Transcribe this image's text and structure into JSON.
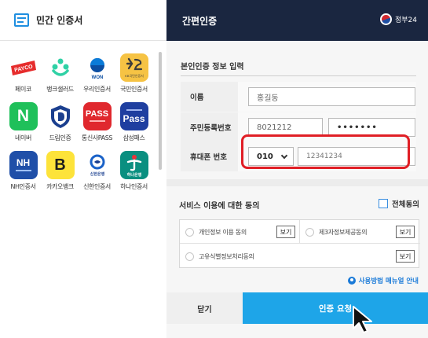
{
  "left_panel": {
    "title": "민간 인증서",
    "providers": [
      {
        "name": "payco",
        "label": "페이코",
        "logo_text": "PAYCO",
        "bg": "#ffffff",
        "fg": "#ffffff",
        "accent": "#e62c2c",
        "icon": "payco-icon"
      },
      {
        "name": "banksalad",
        "label": "뱅크샐러드",
        "logo_text": "",
        "bg": "#ffffff",
        "fg": "#2fd1a5",
        "accent": "#2fd1a5",
        "icon": "banksalad-icon"
      },
      {
        "name": "woori",
        "label": "우리인증서",
        "logo_text": "WON",
        "bg": "#ffffff",
        "fg": "#0b4ea2",
        "accent": "#0b7bd8",
        "icon": "woori-icon"
      },
      {
        "name": "kb",
        "label": "국민인증서",
        "logo_text": "KB국민인증서",
        "bg": "#f6c344",
        "fg": "#3c3c3c",
        "accent": "#3c3c3c",
        "icon": "kb-icon"
      },
      {
        "name": "naver",
        "label": "네이버",
        "logo_text": "N",
        "bg": "#1fc05a",
        "fg": "#ffffff",
        "accent": "#1fc05a",
        "icon": "naver-icon"
      },
      {
        "name": "dream",
        "label": "드림인증",
        "logo_text": "",
        "bg": "#ffffff",
        "fg": "#1b3f8f",
        "accent": "#1b3f8f",
        "icon": "dream-icon"
      },
      {
        "name": "pass",
        "label": "통신사PASS",
        "logo_text": "PASS",
        "bg": "#e0282e",
        "fg": "#ffffff",
        "accent": "#e0282e",
        "icon": "pass-icon"
      },
      {
        "name": "samsung",
        "label": "삼성패스",
        "logo_text": "Pass",
        "bg": "#1f3fa0",
        "fg": "#ffffff",
        "accent": "#1f3fa0",
        "icon": "samsung-pass-icon"
      },
      {
        "name": "nh",
        "label": "NH인증서",
        "logo_text": "NH",
        "bg": "#1f4fa8",
        "fg": "#ffffff",
        "accent": "#1f4fa8",
        "icon": "nh-icon"
      },
      {
        "name": "kakaobank",
        "label": "카카오뱅크",
        "logo_text": "B",
        "bg": "#fde33a",
        "fg": "#1c1c1c",
        "accent": "#1c1c1c",
        "icon": "kakaobank-icon"
      },
      {
        "name": "shinhan",
        "label": "신한인증서",
        "logo_text": "신한은행",
        "bg": "#ffffff",
        "fg": "#1a3f8f",
        "accent": "#1a62c8",
        "icon": "shinhan-icon"
      },
      {
        "name": "hana",
        "label": "하나인증서",
        "logo_text": "하나은행",
        "bg": "#0a8f80",
        "fg": "#ffffff",
        "accent": "#0a8f80",
        "icon": "hana-icon"
      }
    ]
  },
  "right_panel": {
    "header_title": "간편인증",
    "gov_label": "정부24",
    "section_title": "본인인증 정보 입력",
    "fields": {
      "name_label": "이름",
      "name_value": "홍길동",
      "rrn_label": "주민등록번호",
      "rrn_front": "8021212",
      "rrn_back": "•••••••",
      "phone_label": "휴대폰 번호",
      "phone_prefix": "010",
      "phone_number": "12341234"
    },
    "agree": {
      "title": "서비스 이용에 대한 동의",
      "all_label": "전체동의",
      "items": [
        {
          "label": "개인정보 이용 동의",
          "view": "보기"
        },
        {
          "label": "제3자정보제공동의",
          "view": "보기"
        },
        {
          "label": "고유식별정보처리동의",
          "view": "보기"
        }
      ]
    },
    "manual_link": "사용방법 매뉴얼 안내",
    "close_button": "닫기",
    "request_button": "인증 요청"
  },
  "colors": {
    "header_bg": "#1a2640",
    "accent_blue": "#1ea5e8",
    "highlight_red": "#e01e25"
  }
}
